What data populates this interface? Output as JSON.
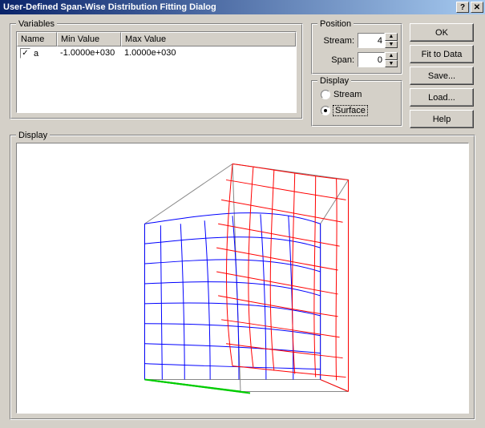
{
  "window": {
    "title": "User-Defined Span-Wise Distribution Fitting Dialog"
  },
  "variables": {
    "legend": "Variables",
    "columns": {
      "name": "Name",
      "min": "Min Value",
      "max": "Max Value"
    },
    "rows": [
      {
        "checked": true,
        "name": "a",
        "min": "-1.0000e+030",
        "max": "1.0000e+030"
      }
    ]
  },
  "position": {
    "legend": "Position",
    "stream_label": "Stream:",
    "stream_value": "4",
    "span_label": "Span:",
    "span_value": "0"
  },
  "display_group": {
    "legend": "Display",
    "stream_label": "Stream",
    "surface_label": "Surface",
    "selected": "surface"
  },
  "buttons": {
    "ok": "OK",
    "fit": "Fit to Data",
    "save": "Save...",
    "load": "Load...",
    "help": "Help"
  },
  "display_panel": {
    "legend": "Display"
  }
}
